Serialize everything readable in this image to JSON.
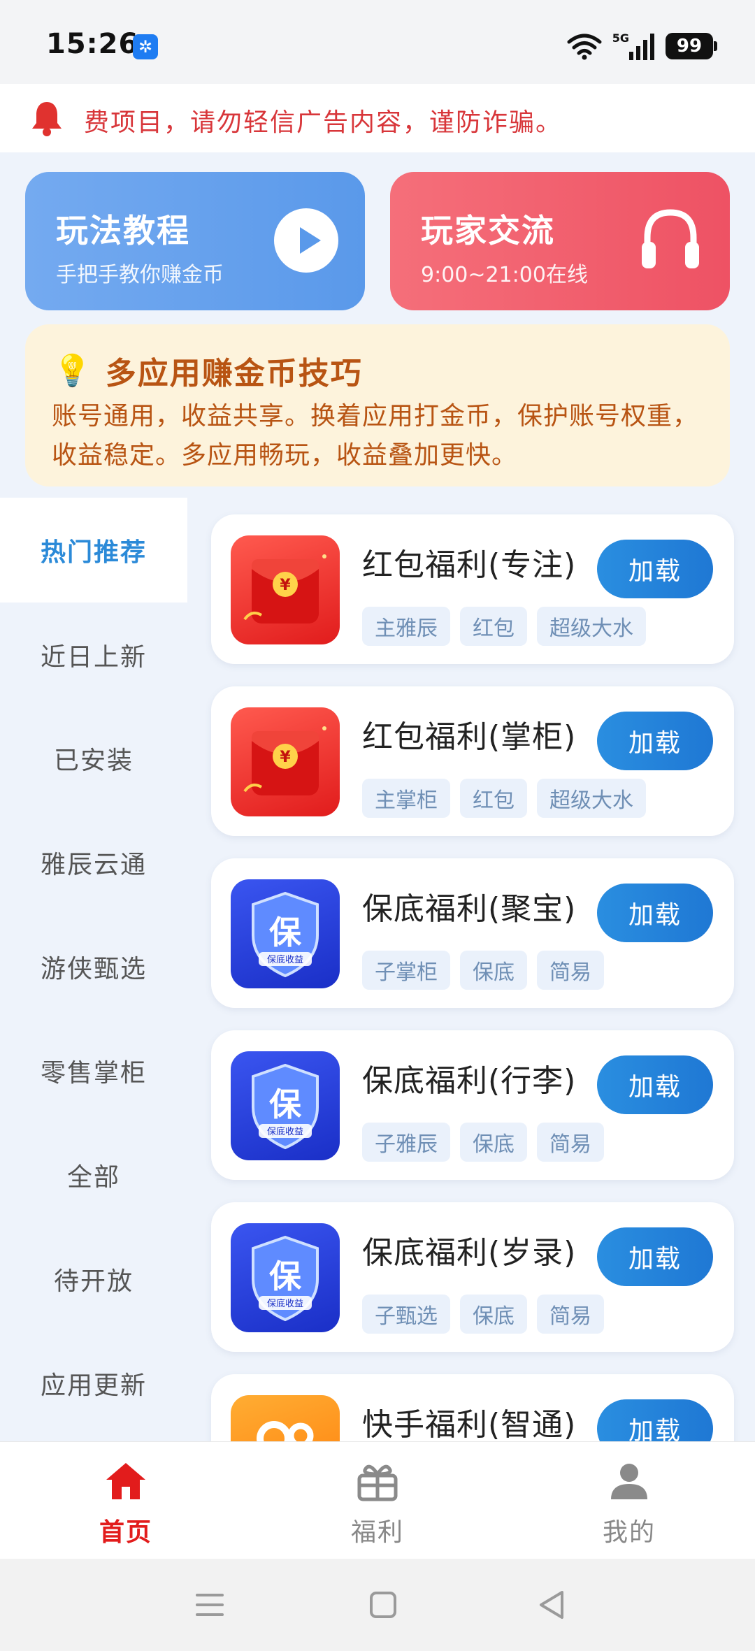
{
  "status_bar": {
    "time": "15:26",
    "network": "5G",
    "battery": "99"
  },
  "notice": {
    "text": "费项目，请勿轻信广告内容，谨防诈骗。"
  },
  "cards": {
    "tutorial": {
      "title": "玩法教程",
      "subtitle": "手把手教你赚金币"
    },
    "chat": {
      "title": "玩家交流",
      "subtitle": "9:00~21:00在线"
    }
  },
  "tips": {
    "title": "多应用赚金币技巧",
    "body": "账号通用，收益共享。换着应用打金币，保护账号权重，收益稳定。多应用畅玩，收益叠加更快。"
  },
  "sidebar": {
    "items": [
      {
        "label": "热门推荐"
      },
      {
        "label": "近日上新"
      },
      {
        "label": "已安装"
      },
      {
        "label": "雅辰云通"
      },
      {
        "label": "游侠甄选"
      },
      {
        "label": "零售掌柜"
      },
      {
        "label": "全部"
      },
      {
        "label": "待开放"
      },
      {
        "label": "应用更新"
      }
    ]
  },
  "apps": [
    {
      "name": "红包福利(专注)",
      "tags": [
        "主雅辰",
        "红包",
        "超级大水"
      ],
      "button": "加载",
      "icon_text": "¥"
    },
    {
      "name": "红包福利(掌柜)",
      "tags": [
        "主掌柜",
        "红包",
        "超级大水"
      ],
      "button": "加载",
      "icon_text": "¥"
    },
    {
      "name": "保底福利(聚宝)",
      "tags": [
        "子掌柜",
        "保底",
        "简易"
      ],
      "button": "加载",
      "icon_text": "保",
      "icon_caption": "保底收益"
    },
    {
      "name": "保底福利(行李)",
      "tags": [
        "子雅辰",
        "保底",
        "简易"
      ],
      "button": "加载",
      "icon_text": "保",
      "icon_caption": "保底收益"
    },
    {
      "name": "保底福利(岁录)",
      "tags": [
        "子甄选",
        "保底",
        "简易"
      ],
      "button": "加载",
      "icon_text": "保",
      "icon_caption": "保底收益"
    },
    {
      "name": "快手福利(智通)",
      "tags": [],
      "button": "加载"
    }
  ],
  "bottom_nav": {
    "items": [
      {
        "label": "首页"
      },
      {
        "label": "福利"
      },
      {
        "label": "我的"
      }
    ]
  },
  "colors": {
    "accent_blue": "#2b8ad8",
    "accent_red": "#e21c1c",
    "tips_text": "#b85413"
  }
}
